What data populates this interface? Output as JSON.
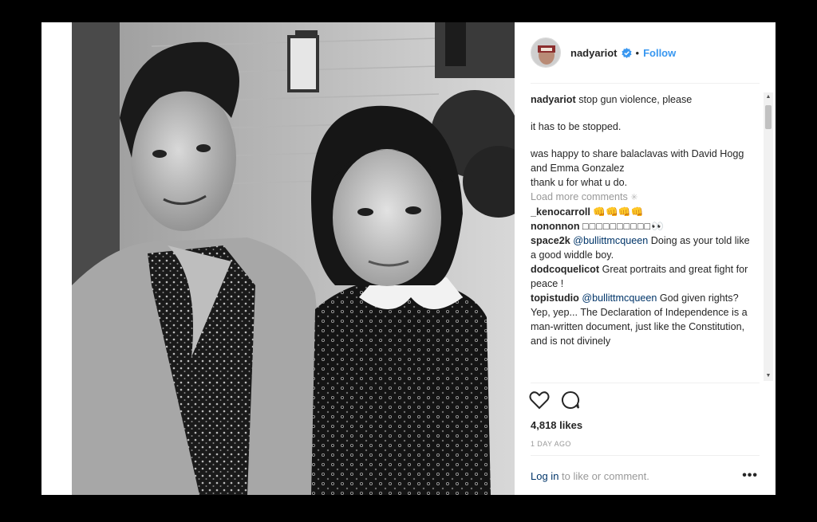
{
  "post": {
    "author": "nadyariot",
    "follow_label": "Follow",
    "separator": "•",
    "caption_user": "nadyariot",
    "caption_line1": "stop gun violence, please",
    "caption_line2": "it has to be stopped.",
    "caption_line3": "was happy to share balaclavas with David Hogg and Emma Gonzalez",
    "caption_line4": "thank u for what u do.",
    "load_more": "Load more comments",
    "comments": [
      {
        "user": "_kenocarroll",
        "mention": "",
        "text": "👊👊👊👊"
      },
      {
        "user": "nononnon",
        "mention": "",
        "text": "□□□□□□□□□□👀"
      },
      {
        "user": "space2k",
        "mention": "@bullittmcqueen",
        "text": "Doing as your told like a good widdle boy."
      },
      {
        "user": "dodcoquelicot",
        "mention": "",
        "text": "Great portraits and great fight for peace !"
      },
      {
        "user": "topistudio",
        "mention": "@bullittmcqueen",
        "text": "God given rights? Yep, yep... The Declaration of Independence is a man-written document, just like the Constitution, and is not divinely"
      }
    ],
    "likes": "4,818 likes",
    "time": "1 DAY AGO",
    "login_link": "Log in",
    "login_rest": " to like or comment.",
    "more_options": "•••"
  },
  "icons": {
    "verified": "verified-badge-icon",
    "like": "heart-icon",
    "comment": "comment-bubble-icon",
    "spinner": "loading-spinner-icon"
  },
  "colors": {
    "link_blue": "#3897f0",
    "mention_blue": "#003569",
    "muted": "#999999",
    "background": "#000000"
  }
}
